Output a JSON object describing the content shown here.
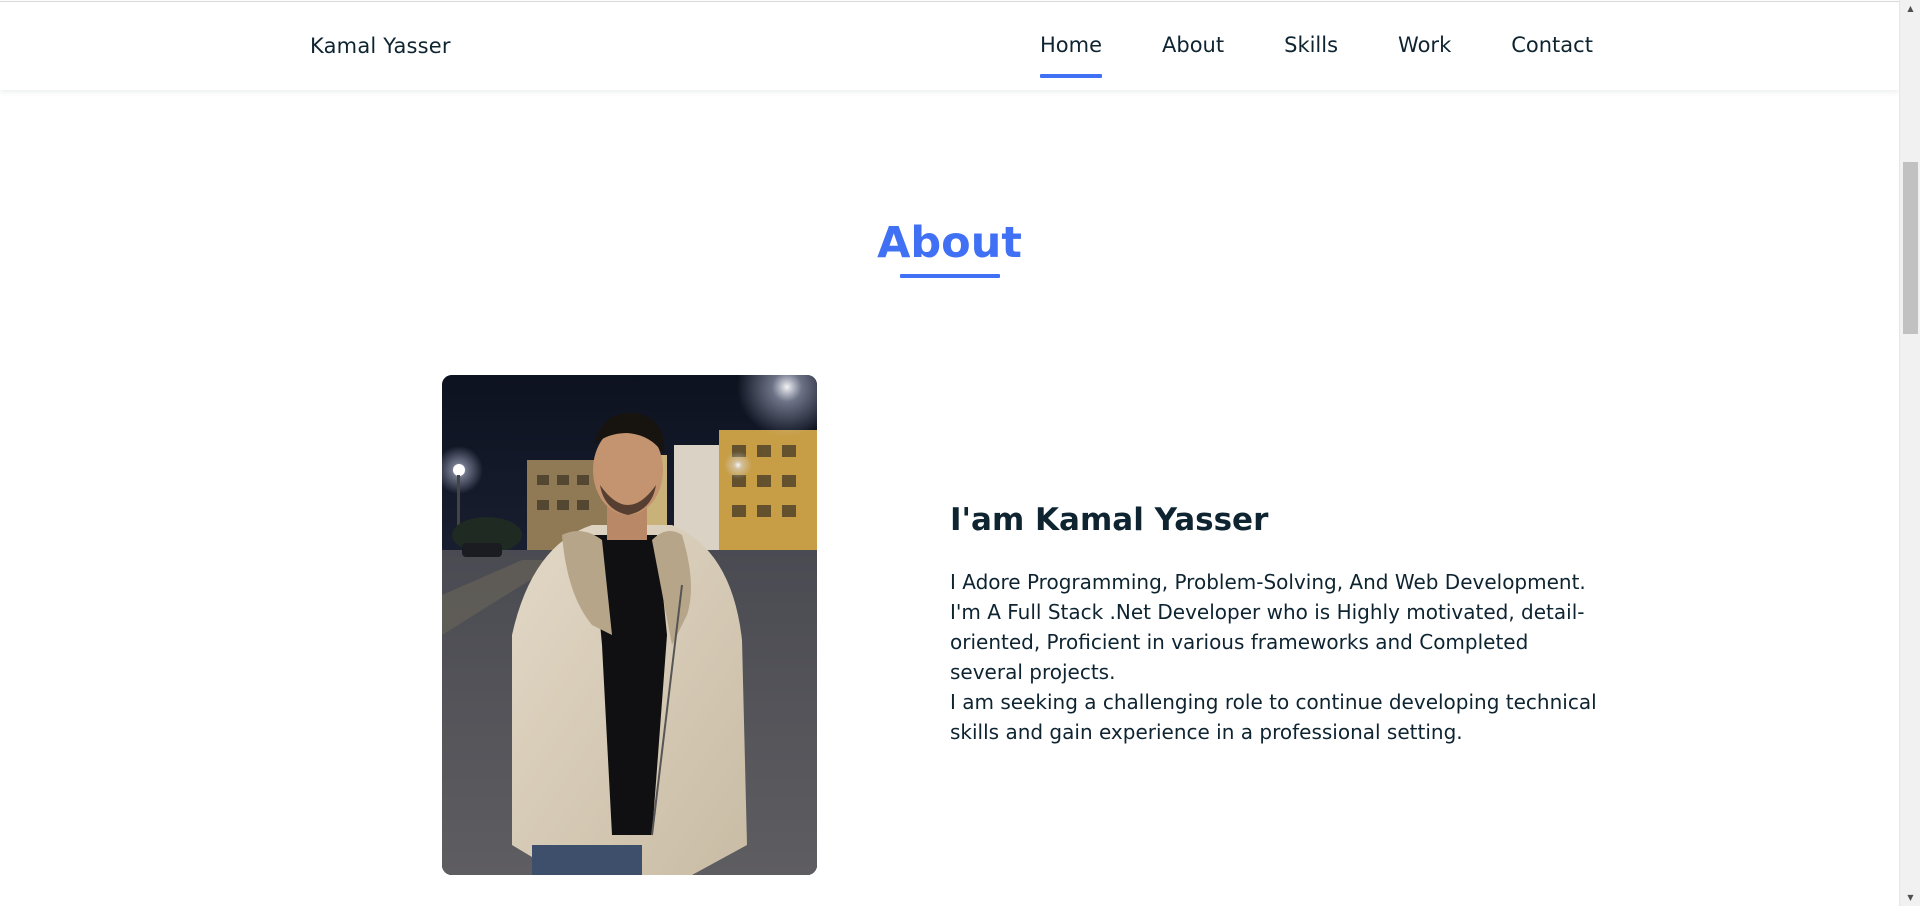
{
  "header": {
    "logo": "Kamal Yasser",
    "nav": [
      {
        "label": "Home",
        "active": true
      },
      {
        "label": "About",
        "active": false
      },
      {
        "label": "Skills",
        "active": false
      },
      {
        "label": "Work",
        "active": false
      },
      {
        "label": "Contact",
        "active": false
      }
    ]
  },
  "about": {
    "title": "About",
    "heading": "I'am Kamal Yasser",
    "paragraph_1": "I Adore Programming, Problem-Solving, And Web Development. I'm A Full Stack .Net Developer who is Highly motivated, detail-oriented, Proficient in various frameworks and Completed several projects.",
    "paragraph_2": "I am seeking a challenging role to continue developing technical skills and gain experience in a professional setting."
  },
  "colors": {
    "accent": "#4070f4",
    "text": "#0e2431",
    "background": "#ffffff"
  },
  "icons": {
    "scroll_up": "scroll-up-arrow-icon",
    "scroll_down": "scroll-down-arrow-icon"
  }
}
